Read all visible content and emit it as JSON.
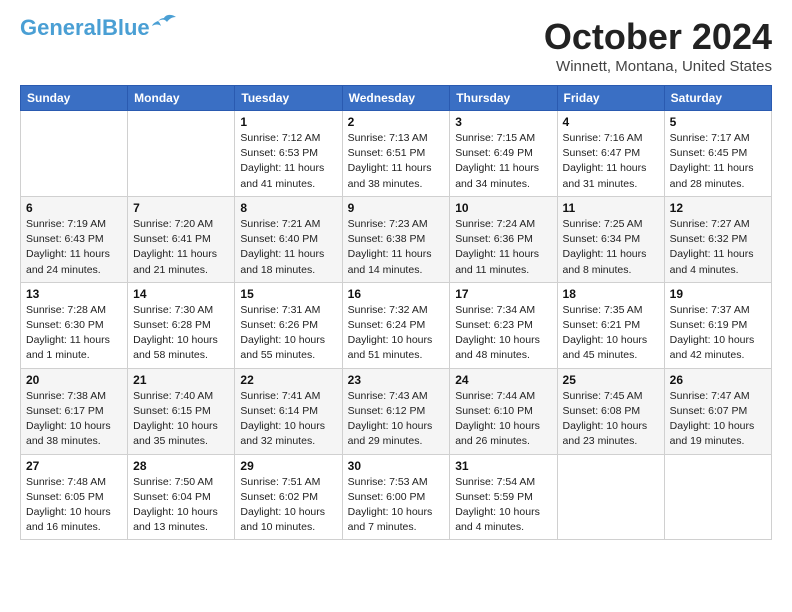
{
  "header": {
    "logo_line1": "General",
    "logo_line2": "Blue",
    "month": "October 2024",
    "location": "Winnett, Montana, United States"
  },
  "days_of_week": [
    "Sunday",
    "Monday",
    "Tuesday",
    "Wednesday",
    "Thursday",
    "Friday",
    "Saturday"
  ],
  "weeks": [
    [
      {
        "day": "",
        "info": ""
      },
      {
        "day": "",
        "info": ""
      },
      {
        "day": "1",
        "info": "Sunrise: 7:12 AM\nSunset: 6:53 PM\nDaylight: 11 hours and 41 minutes."
      },
      {
        "day": "2",
        "info": "Sunrise: 7:13 AM\nSunset: 6:51 PM\nDaylight: 11 hours and 38 minutes."
      },
      {
        "day": "3",
        "info": "Sunrise: 7:15 AM\nSunset: 6:49 PM\nDaylight: 11 hours and 34 minutes."
      },
      {
        "day": "4",
        "info": "Sunrise: 7:16 AM\nSunset: 6:47 PM\nDaylight: 11 hours and 31 minutes."
      },
      {
        "day": "5",
        "info": "Sunrise: 7:17 AM\nSunset: 6:45 PM\nDaylight: 11 hours and 28 minutes."
      }
    ],
    [
      {
        "day": "6",
        "info": "Sunrise: 7:19 AM\nSunset: 6:43 PM\nDaylight: 11 hours and 24 minutes."
      },
      {
        "day": "7",
        "info": "Sunrise: 7:20 AM\nSunset: 6:41 PM\nDaylight: 11 hours and 21 minutes."
      },
      {
        "day": "8",
        "info": "Sunrise: 7:21 AM\nSunset: 6:40 PM\nDaylight: 11 hours and 18 minutes."
      },
      {
        "day": "9",
        "info": "Sunrise: 7:23 AM\nSunset: 6:38 PM\nDaylight: 11 hours and 14 minutes."
      },
      {
        "day": "10",
        "info": "Sunrise: 7:24 AM\nSunset: 6:36 PM\nDaylight: 11 hours and 11 minutes."
      },
      {
        "day": "11",
        "info": "Sunrise: 7:25 AM\nSunset: 6:34 PM\nDaylight: 11 hours and 8 minutes."
      },
      {
        "day": "12",
        "info": "Sunrise: 7:27 AM\nSunset: 6:32 PM\nDaylight: 11 hours and 4 minutes."
      }
    ],
    [
      {
        "day": "13",
        "info": "Sunrise: 7:28 AM\nSunset: 6:30 PM\nDaylight: 11 hours and 1 minute."
      },
      {
        "day": "14",
        "info": "Sunrise: 7:30 AM\nSunset: 6:28 PM\nDaylight: 10 hours and 58 minutes."
      },
      {
        "day": "15",
        "info": "Sunrise: 7:31 AM\nSunset: 6:26 PM\nDaylight: 10 hours and 55 minutes."
      },
      {
        "day": "16",
        "info": "Sunrise: 7:32 AM\nSunset: 6:24 PM\nDaylight: 10 hours and 51 minutes."
      },
      {
        "day": "17",
        "info": "Sunrise: 7:34 AM\nSunset: 6:23 PM\nDaylight: 10 hours and 48 minutes."
      },
      {
        "day": "18",
        "info": "Sunrise: 7:35 AM\nSunset: 6:21 PM\nDaylight: 10 hours and 45 minutes."
      },
      {
        "day": "19",
        "info": "Sunrise: 7:37 AM\nSunset: 6:19 PM\nDaylight: 10 hours and 42 minutes."
      }
    ],
    [
      {
        "day": "20",
        "info": "Sunrise: 7:38 AM\nSunset: 6:17 PM\nDaylight: 10 hours and 38 minutes."
      },
      {
        "day": "21",
        "info": "Sunrise: 7:40 AM\nSunset: 6:15 PM\nDaylight: 10 hours and 35 minutes."
      },
      {
        "day": "22",
        "info": "Sunrise: 7:41 AM\nSunset: 6:14 PM\nDaylight: 10 hours and 32 minutes."
      },
      {
        "day": "23",
        "info": "Sunrise: 7:43 AM\nSunset: 6:12 PM\nDaylight: 10 hours and 29 minutes."
      },
      {
        "day": "24",
        "info": "Sunrise: 7:44 AM\nSunset: 6:10 PM\nDaylight: 10 hours and 26 minutes."
      },
      {
        "day": "25",
        "info": "Sunrise: 7:45 AM\nSunset: 6:08 PM\nDaylight: 10 hours and 23 minutes."
      },
      {
        "day": "26",
        "info": "Sunrise: 7:47 AM\nSunset: 6:07 PM\nDaylight: 10 hours and 19 minutes."
      }
    ],
    [
      {
        "day": "27",
        "info": "Sunrise: 7:48 AM\nSunset: 6:05 PM\nDaylight: 10 hours and 16 minutes."
      },
      {
        "day": "28",
        "info": "Sunrise: 7:50 AM\nSunset: 6:04 PM\nDaylight: 10 hours and 13 minutes."
      },
      {
        "day": "29",
        "info": "Sunrise: 7:51 AM\nSunset: 6:02 PM\nDaylight: 10 hours and 10 minutes."
      },
      {
        "day": "30",
        "info": "Sunrise: 7:53 AM\nSunset: 6:00 PM\nDaylight: 10 hours and 7 minutes."
      },
      {
        "day": "31",
        "info": "Sunrise: 7:54 AM\nSunset: 5:59 PM\nDaylight: 10 hours and 4 minutes."
      },
      {
        "day": "",
        "info": ""
      },
      {
        "day": "",
        "info": ""
      }
    ]
  ]
}
